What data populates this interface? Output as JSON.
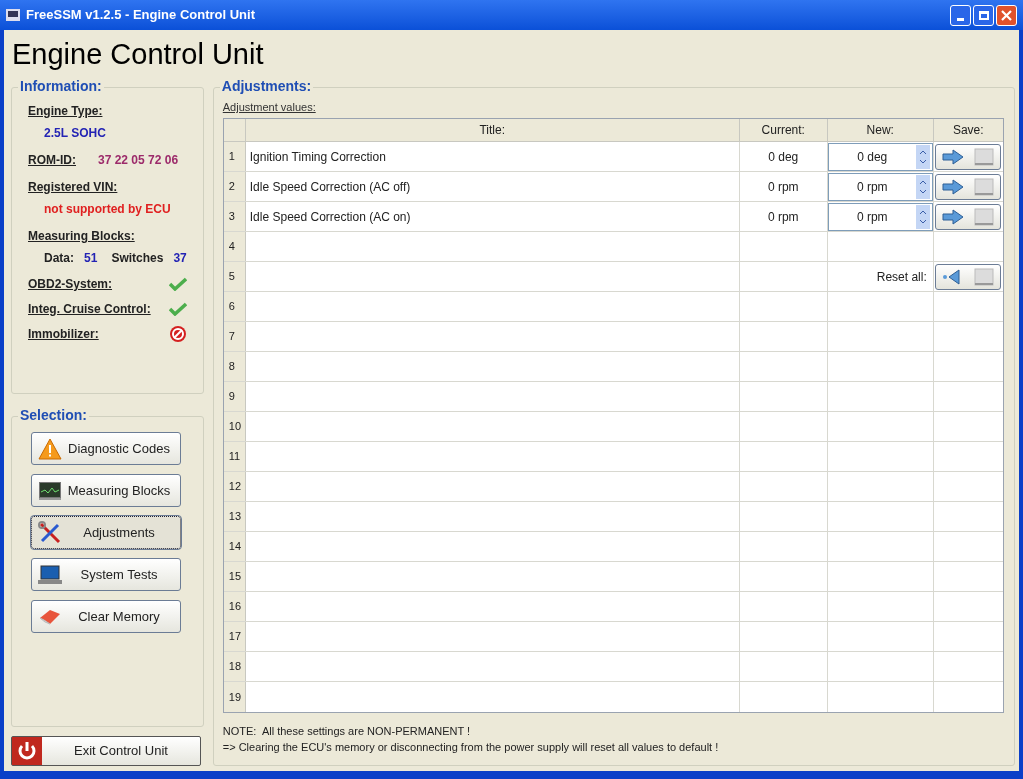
{
  "window": {
    "title": "FreeSSM v1.2.5 - Engine Control Unit"
  },
  "heading": "Engine Control Unit",
  "information": {
    "title": "Information:",
    "items": [
      {
        "kind": "below",
        "label": "Engine Type:",
        "value": "2.5L SOHC",
        "color": "#2323b4"
      },
      {
        "kind": "inline",
        "label": "ROM-ID:",
        "value": "37 22 05 72 06",
        "color": "#9c2a6a"
      },
      {
        "kind": "below",
        "label": "Registered VIN:",
        "value": "not supported by ECU",
        "color": "#e02020"
      },
      {
        "kind": "blocks",
        "label": "Measuring Blocks:",
        "data_label": "Data:",
        "data_value": "51",
        "switches_label": "Switches",
        "switches_value": "37"
      },
      {
        "kind": "status",
        "label": "OBD2-System:",
        "enabled": true
      },
      {
        "kind": "status",
        "label": "Integ. Cruise Control:",
        "enabled": true
      },
      {
        "kind": "status",
        "label": "Immobilizer:",
        "enabled": false
      }
    ]
  },
  "selection": {
    "title": "Selection:",
    "buttons": [
      {
        "label": "Diagnostic Codes",
        "kind": "warning",
        "selected": false
      },
      {
        "label": "Measuring Blocks",
        "kind": "monitor",
        "selected": false
      },
      {
        "label": "Adjustments",
        "kind": "tools",
        "selected": true
      },
      {
        "label": "System Tests",
        "kind": "laptop",
        "selected": false
      },
      {
        "label": "Clear Memory",
        "kind": "eraser",
        "selected": false
      }
    ]
  },
  "exit_button": "Exit Control Unit",
  "adjustments": {
    "title": "Adjustments:",
    "subtitle": "Adjustment values:",
    "columns": [
      "Title:",
      "Current:",
      "New:",
      "Save:"
    ],
    "rows": [
      {
        "number": "1",
        "title": "Ignition Timing Correction",
        "current": "0 deg",
        "new": "0 deg"
      },
      {
        "number": "2",
        "title": "Idle Speed Correction (AC off)",
        "current": "0 rpm",
        "new": "0 rpm"
      },
      {
        "number": "3",
        "title": "Idle Speed Correction (AC on)",
        "current": "0 rpm",
        "new": "0 rpm"
      },
      {
        "number": "4"
      },
      {
        "number": "5",
        "reset_label": "Reset all:"
      },
      {
        "number": "6"
      },
      {
        "number": "7"
      },
      {
        "number": "8"
      },
      {
        "number": "9"
      },
      {
        "number": "10"
      },
      {
        "number": "11"
      },
      {
        "number": "12"
      },
      {
        "number": "13"
      },
      {
        "number": "14"
      },
      {
        "number": "15"
      },
      {
        "number": "16"
      },
      {
        "number": "17"
      },
      {
        "number": "18"
      },
      {
        "number": "19"
      }
    ],
    "notes": [
      "NOTE:  All these settings are NON-PERMANENT !",
      "=> Clearing the ECU's memory or disconnecting from the power supply will reset all values to default !"
    ]
  }
}
